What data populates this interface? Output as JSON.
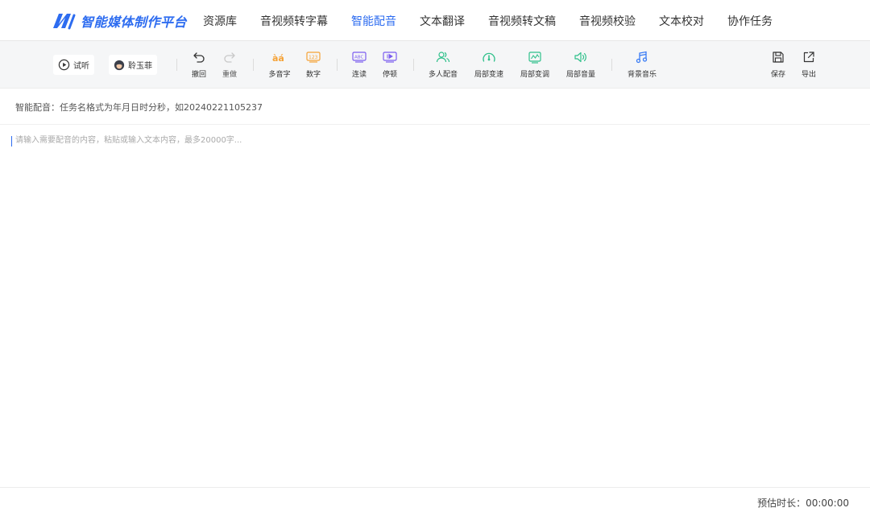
{
  "header": {
    "logo_text": "智能媒体制作平台",
    "nav": [
      {
        "label": "资源库",
        "active": false
      },
      {
        "label": "音视频转字幕",
        "active": false
      },
      {
        "label": "智能配音",
        "active": true
      },
      {
        "label": "文本翻译",
        "active": false
      },
      {
        "label": "音视频转文稿",
        "active": false
      },
      {
        "label": "音视频校验",
        "active": false
      },
      {
        "label": "文本校对",
        "active": false
      },
      {
        "label": "协作任务",
        "active": false
      }
    ]
  },
  "toolbar": {
    "preview_label": "试听",
    "voice_label": "聆玉菲",
    "undo_label": "撤回",
    "redo_label": "重做",
    "polyphone_label": "多音字",
    "number_label": "数字",
    "liaison_label": "连读",
    "pause_label": "停顿",
    "multi_voice_label": "多人配音",
    "local_speed_label": "局部变速",
    "local_pitch_label": "局部变调",
    "local_volume_label": "局部音量",
    "bgm_label": "背景音乐",
    "save_label": "保存",
    "export_label": "导出"
  },
  "info": {
    "task_hint": "智能配音：任务名格式为年月日时分秒，如20240221105237"
  },
  "editor": {
    "placeholder": "请输入需要配音的内容，粘贴或输入文本内容，最多20000字..."
  },
  "footer": {
    "duration_label": "预估时长：",
    "duration_value": "00:00:00"
  },
  "colors": {
    "brand": "#2d6cf0",
    "orange": "#f5a236",
    "purple": "#7b5cf0",
    "green": "#2ec08a",
    "blue": "#3a7cf5"
  }
}
